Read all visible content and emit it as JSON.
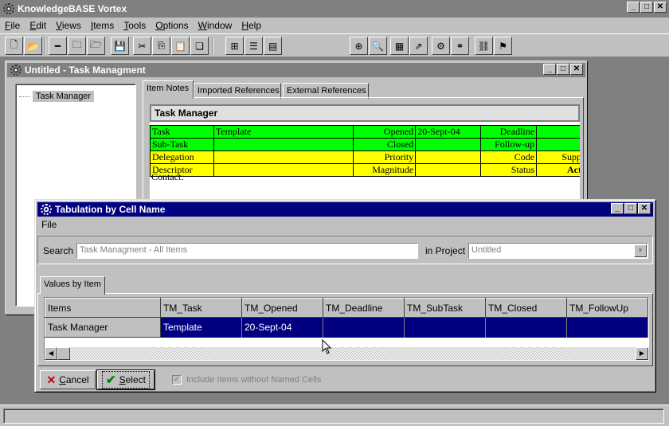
{
  "app": {
    "title": "KnowledgeBASE Vortex",
    "menu": [
      "File",
      "Edit",
      "Views",
      "Items",
      "Tools",
      "Options",
      "Window",
      "Help"
    ]
  },
  "task_window": {
    "title": "Untitled - Task Managment",
    "tree": {
      "node_label": "Task Manager"
    },
    "tabs": [
      "Item Notes",
      "Imported References",
      "External References"
    ],
    "notes": {
      "header": "Task Manager",
      "rows": [
        [
          "Task",
          "Template",
          "Opened",
          "20-Sept-04",
          "Deadline",
          ""
        ],
        [
          "Sub-Task",
          "",
          "Closed",
          "",
          "Follow-up",
          ""
        ],
        [
          "Delegation",
          "",
          "Priority",
          "",
          "Code",
          "Supp"
        ],
        [
          "Descriptor",
          "",
          "Magnitude",
          "",
          "Status",
          "Act"
        ]
      ],
      "contact_label": "Contact:"
    }
  },
  "dialog": {
    "title": "Tabulation by Cell Name",
    "menu_file": "File",
    "search_label": "Search",
    "search_value": "Task Managment - All Items",
    "project_label": "in Project",
    "project_value": "Untitled",
    "tab_label": "Values by Item",
    "columns": [
      "Items",
      "TM_Task",
      "TM_Opened",
      "TM_Deadline",
      "TM_SubTask",
      "TM_Closed",
      "TM_FollowUp"
    ],
    "rows": [
      [
        "Task Manager",
        "Template",
        "20-Sept-04",
        "",
        "",
        "",
        ""
      ]
    ],
    "cancel_label": "Cancel",
    "select_label": "Select",
    "include_label": "Include Items without Named Cells"
  },
  "colors": {
    "active_title": "#000080",
    "inactive_title": "#808080",
    "row_green": "#00ff00",
    "row_yellow": "#ffff00"
  },
  "icons": [
    "new-icon",
    "open-icon",
    "minus-icon",
    "folder-icon",
    "folders-icon",
    "save-icon",
    "cut-icon",
    "copy-icon",
    "paste-icon",
    "delete-icon",
    "tree-icon",
    "list-icon",
    "report-icon",
    "globe-icon",
    "search-icon",
    "table-icon",
    "export-icon",
    "settings-icon",
    "binoculars-icon",
    "network-icon",
    "flags-icon"
  ]
}
